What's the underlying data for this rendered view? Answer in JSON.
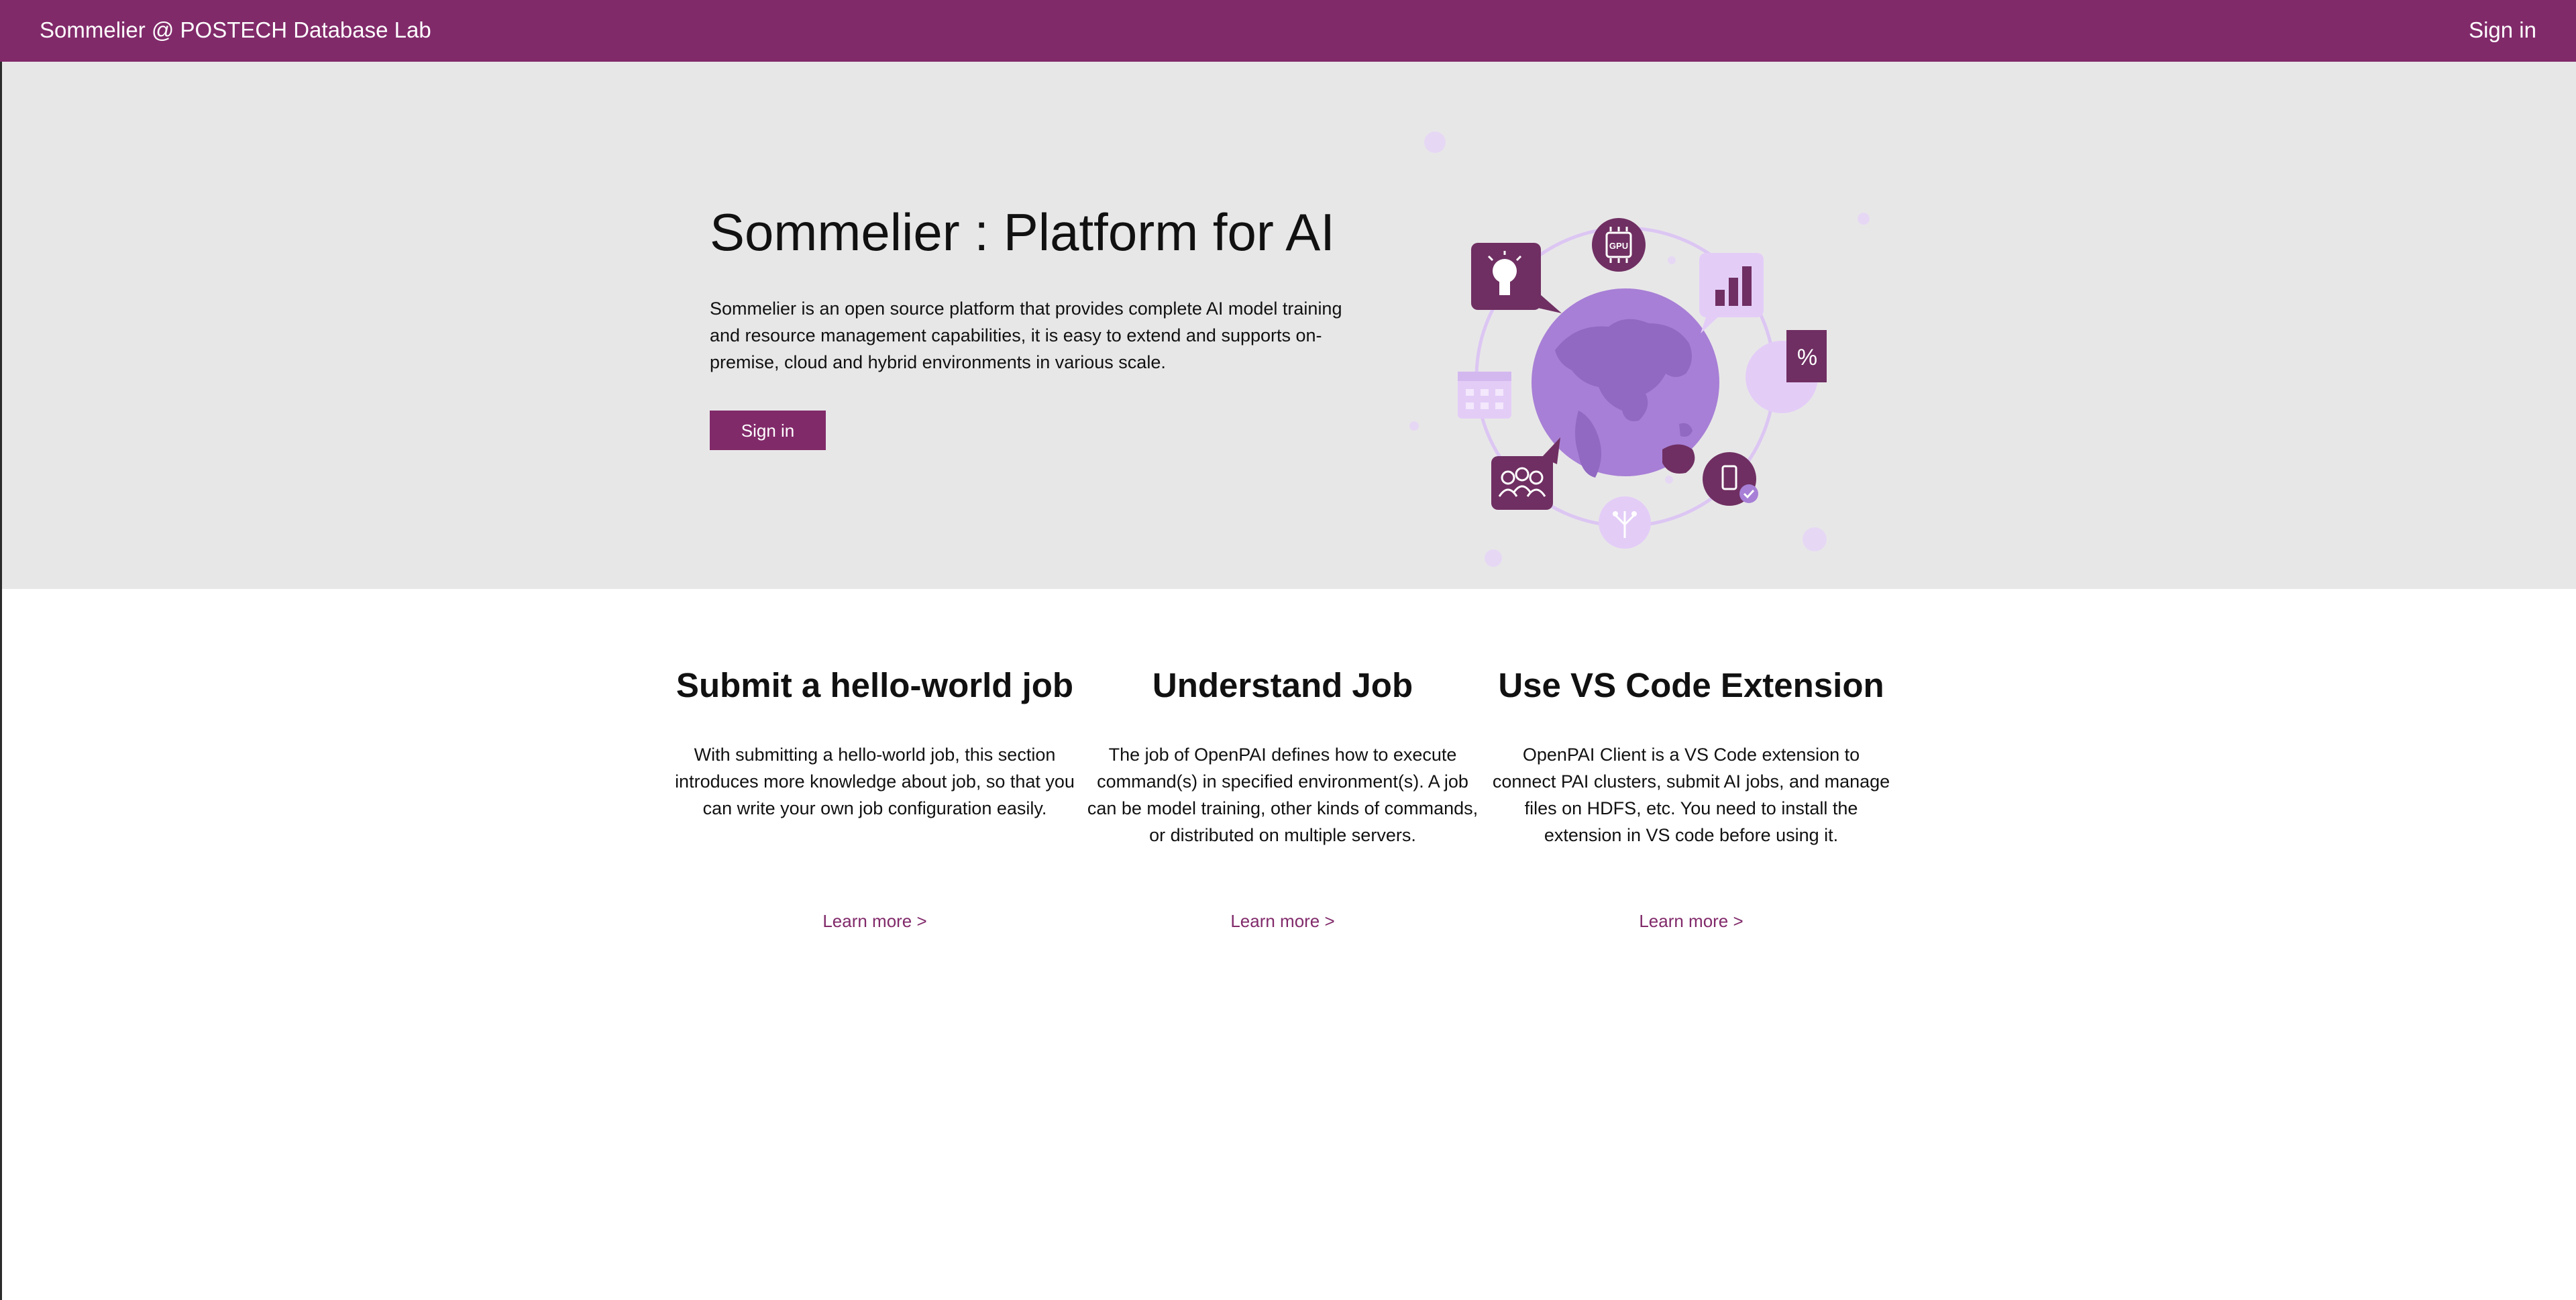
{
  "header": {
    "brand": "Sommelier @ POSTECH Database Lab",
    "sign_in": "Sign in"
  },
  "hero": {
    "title": "Sommelier : Platform for AI",
    "description": "Sommelier is an open source platform that provides complete AI model training and resource management capabilities, it is easy to extend and supports on-premise, cloud and hybrid environments in various scale.",
    "button": "Sign in",
    "illustration": {
      "gpu_label": "GPU",
      "percent_label": "%",
      "icons": [
        "lightbulb-icon",
        "gpu-chip-icon",
        "bar-chart-icon",
        "percent-pie-icon",
        "calendar-icon",
        "people-icon",
        "mobile-icon",
        "circuit-icon",
        "globe-icon"
      ]
    }
  },
  "cards": [
    {
      "title": "Submit a hello-world job",
      "description": "With submitting a hello-world job, this section introduces more knowledge about job, so that you can write your own job configuration easily.",
      "link": "Learn more >"
    },
    {
      "title": "Understand Job",
      "description": "The job of OpenPAI defines how to execute command(s) in specified environment(s). A job can be model training, other kinds of commands, or distributed on multiple servers.",
      "link": "Learn more >"
    },
    {
      "title": "Use VS Code Extension",
      "description": "OpenPAI Client is a VS Code extension to connect PAI clusters, submit AI jobs, and manage files on HDFS, etc. You need to install the extension in VS code before using it.",
      "link": "Learn more >"
    }
  ],
  "colors": {
    "brand": "#812a6a",
    "hero_bg": "#e8e7e8",
    "illustration_dark": "#6f2f62",
    "illustration_mid": "#a77fd6",
    "illustration_light": "#e3cdf7"
  }
}
